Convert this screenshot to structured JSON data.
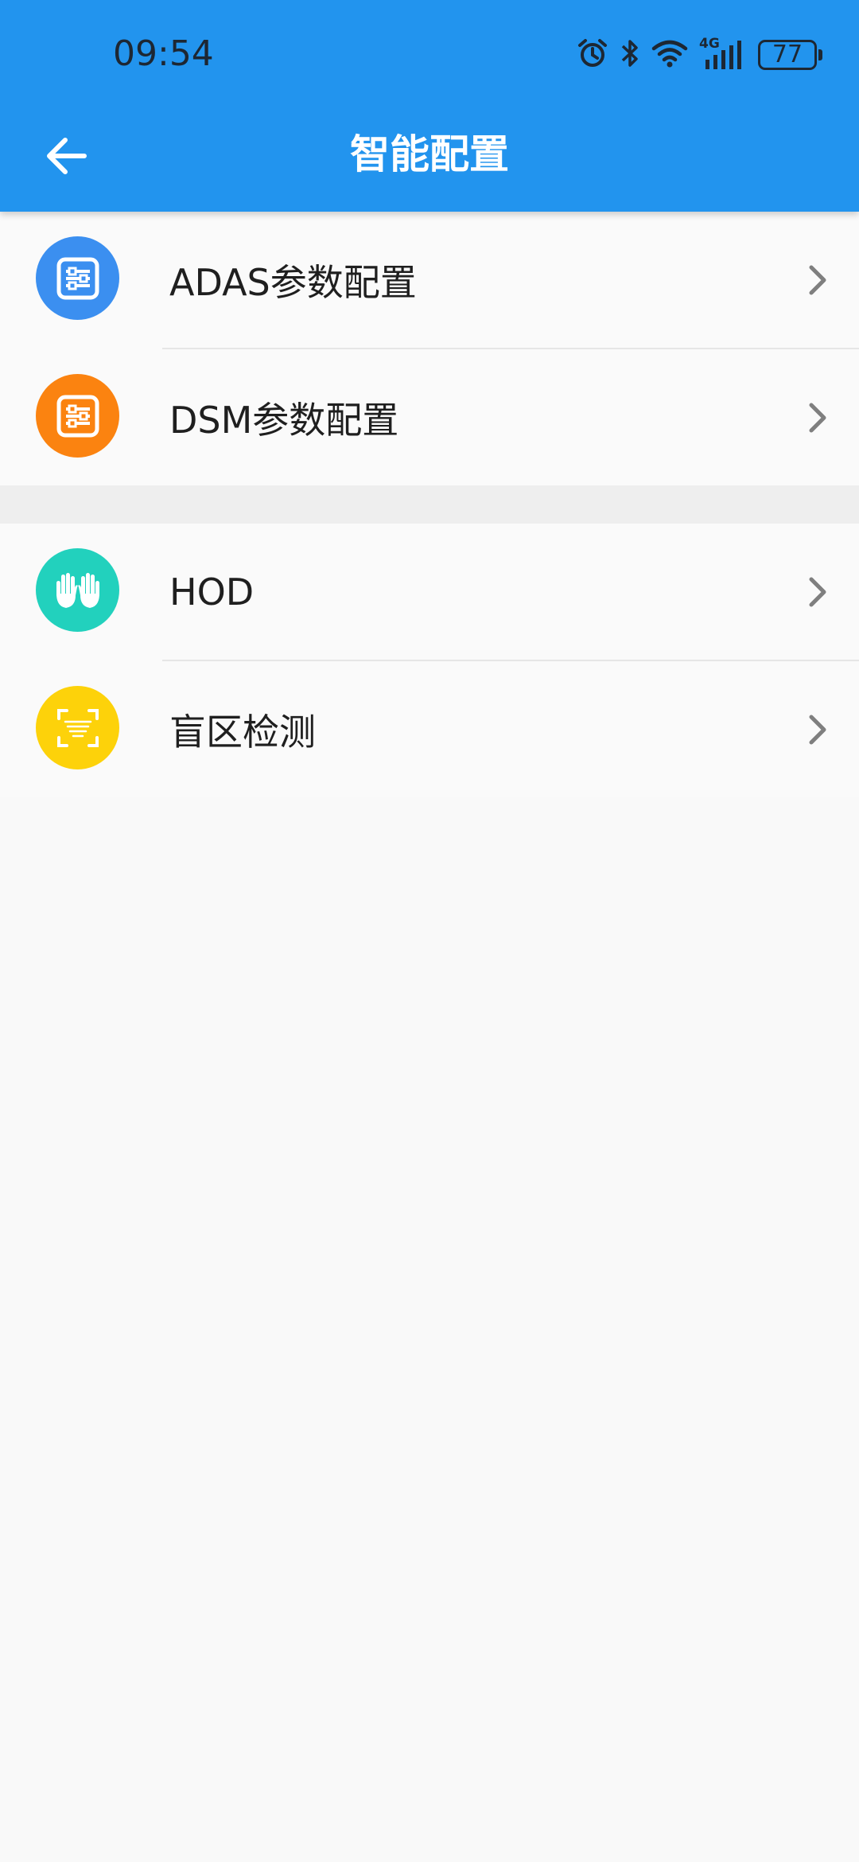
{
  "status_bar": {
    "time": "09:54",
    "battery": "77",
    "network": "4G",
    "icons": [
      "alarm-icon",
      "bluetooth-icon",
      "wifi-icon",
      "cellular-signal-icon",
      "battery-icon"
    ]
  },
  "header": {
    "title": "智能配置",
    "back_icon": "arrow-left-icon",
    "color": "#2294ee"
  },
  "groups": [
    {
      "items": [
        {
          "label": "ADAS参数配置",
          "icon": "sliders-icon",
          "color": "#3b8ff0"
        },
        {
          "label": "DSM参数配置",
          "icon": "sliders-icon",
          "color": "#fb8310"
        }
      ]
    },
    {
      "items": [
        {
          "label": "HOD",
          "icon": "hands-icon",
          "color": "#22d1bd"
        },
        {
          "label": "盲区检测",
          "icon": "scan-icon",
          "color": "#fdd20a"
        }
      ]
    }
  ]
}
